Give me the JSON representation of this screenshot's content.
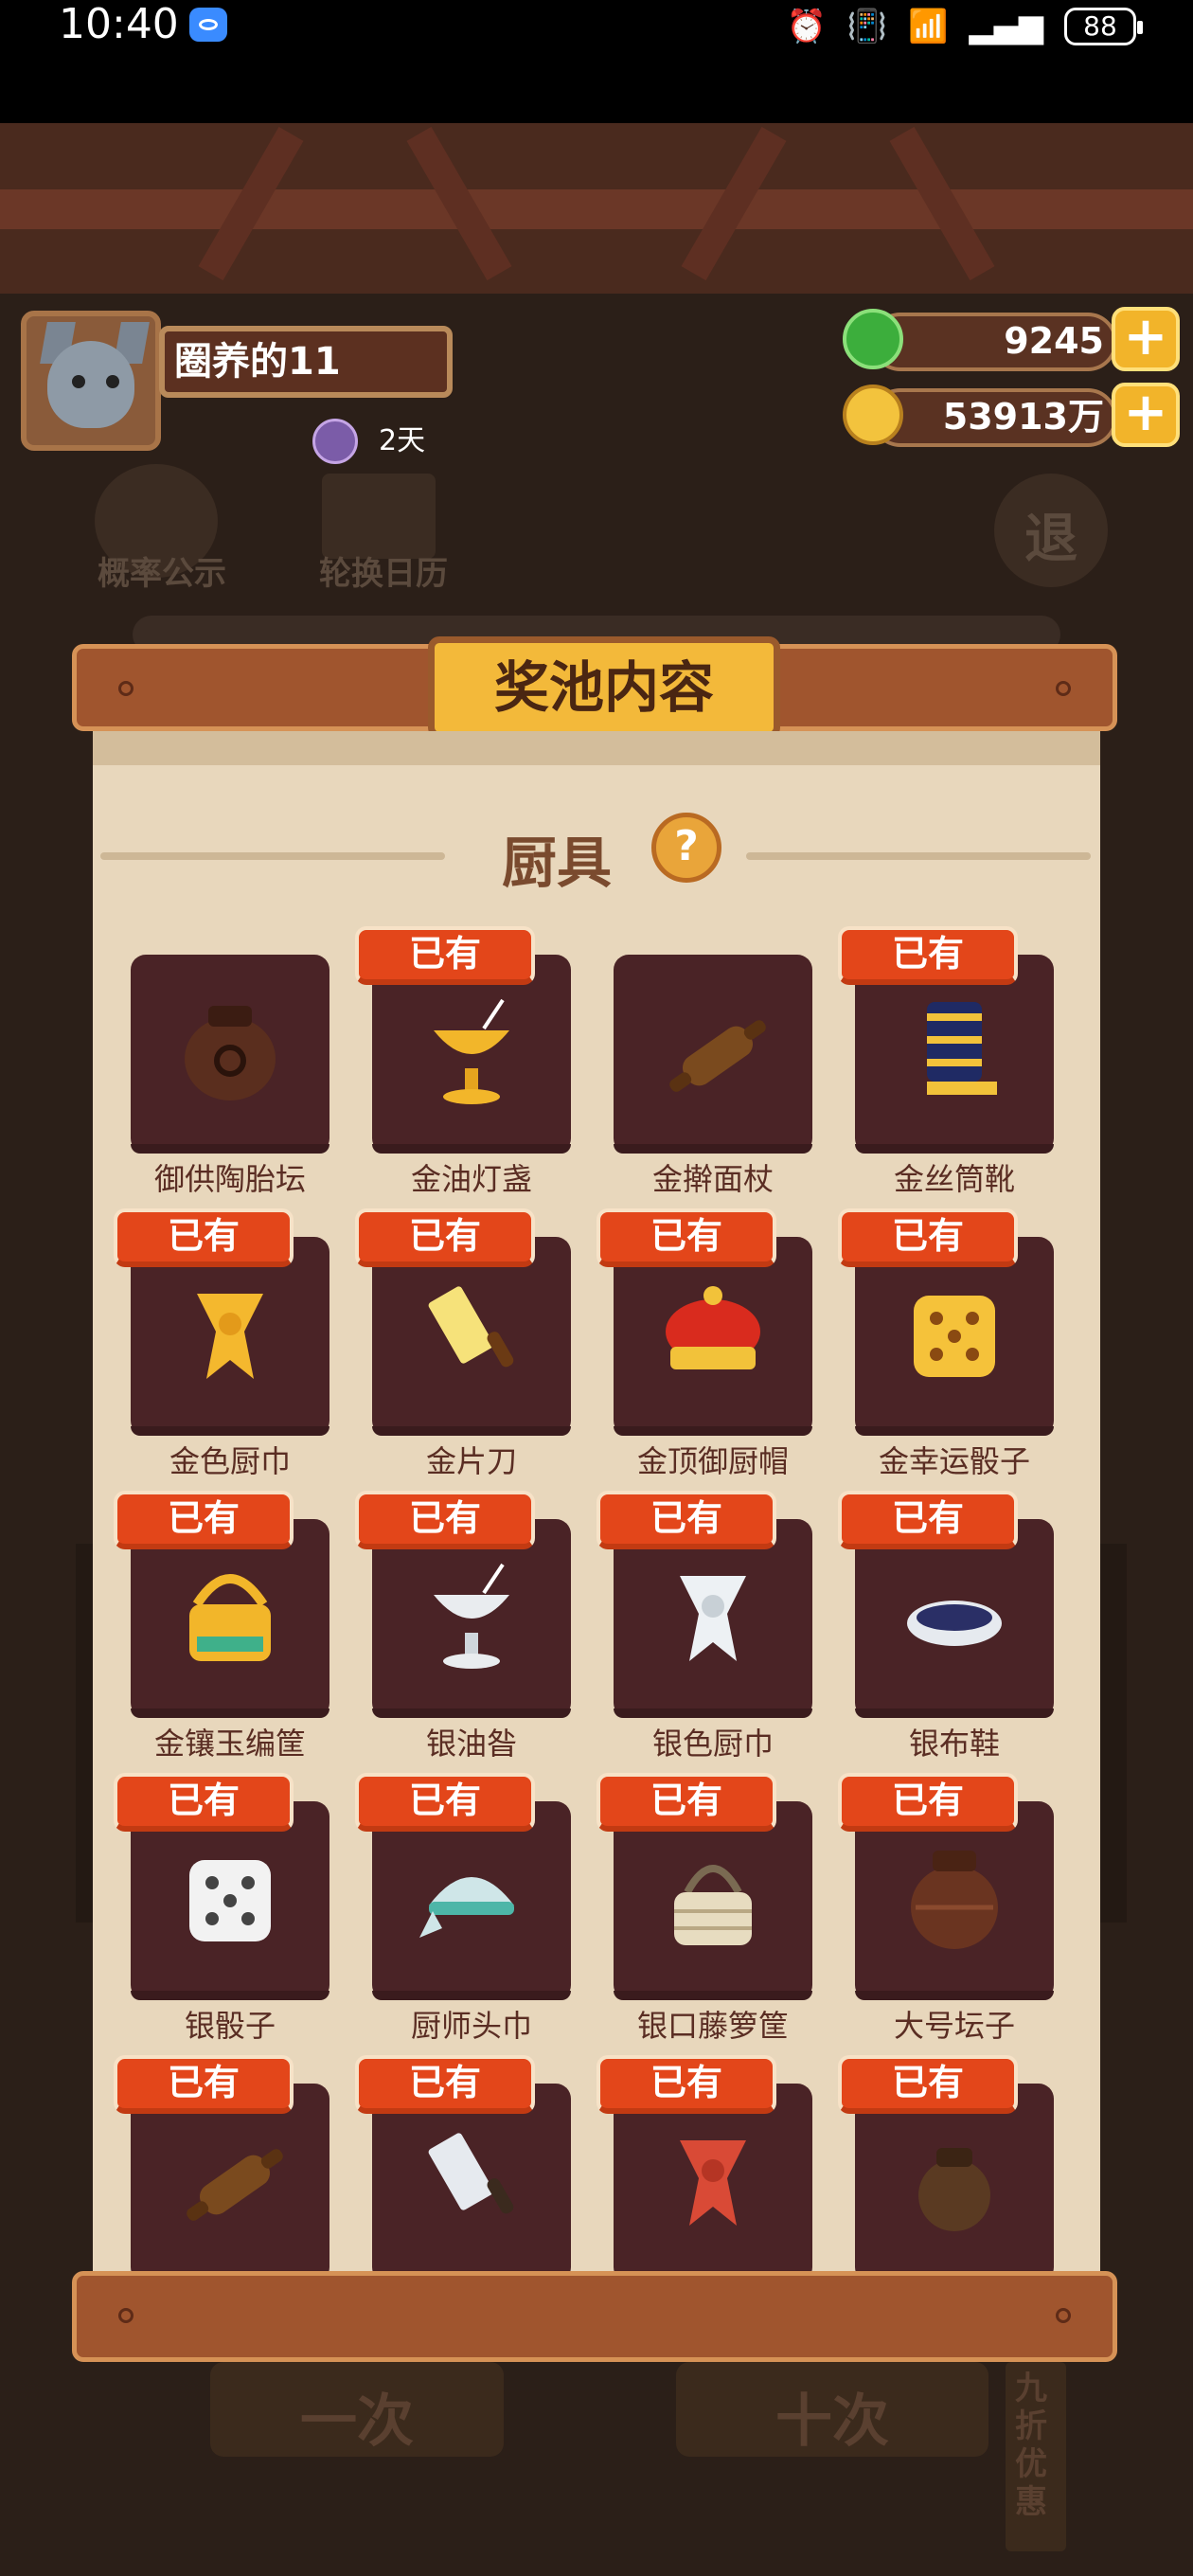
{
  "status_bar": {
    "time": "10:40",
    "battery": "88",
    "icons": [
      "alarm-icon",
      "vibrate-icon",
      "wifi-icon",
      "signal-icon"
    ]
  },
  "player": {
    "name": "圈养的11",
    "days": "2天"
  },
  "resources": {
    "jade": "9245",
    "coins": "53913万"
  },
  "background_buttons": {
    "probability": "概率公示",
    "calendar": "轮换日历",
    "exit": "退",
    "discount": "九折优惠",
    "draw_one": "一次",
    "draw_ten": "十次"
  },
  "modal": {
    "title": "奖池内容",
    "section_title": "厨具",
    "help_label": "?",
    "owned_label": "已有",
    "items": [
      {
        "name": "御供陶胎坛",
        "owned": false,
        "icon": "ceramic-jar-icon"
      },
      {
        "name": "金油灯盏",
        "owned": true,
        "icon": "golden-oil-lamp-icon"
      },
      {
        "name": "金擀面杖",
        "owned": false,
        "icon": "rolling-pin-icon"
      },
      {
        "name": "金丝筒靴",
        "owned": true,
        "icon": "boot-icon"
      },
      {
        "name": "金色厨巾",
        "owned": true,
        "icon": "golden-scarf-icon"
      },
      {
        "name": "金片刀",
        "owned": true,
        "icon": "golden-cleaver-icon"
      },
      {
        "name": "金顶御厨帽",
        "owned": true,
        "icon": "chef-hat-icon"
      },
      {
        "name": "金幸运骰子",
        "owned": true,
        "icon": "golden-dice-icon"
      },
      {
        "name": "金镶玉编筐",
        "owned": true,
        "icon": "golden-basket-icon"
      },
      {
        "name": "银油昝",
        "owned": true,
        "icon": "silver-oil-lamp-icon"
      },
      {
        "name": "银色厨巾",
        "owned": true,
        "icon": "silver-scarf-icon"
      },
      {
        "name": "银布鞋",
        "owned": true,
        "icon": "silver-shoe-icon"
      },
      {
        "name": "银骰子",
        "owned": true,
        "icon": "silver-dice-icon"
      },
      {
        "name": "厨师头巾",
        "owned": true,
        "icon": "chef-bandana-icon"
      },
      {
        "name": "银口藤箩筐",
        "owned": true,
        "icon": "rattan-basket-icon"
      },
      {
        "name": "大号坛子",
        "owned": true,
        "icon": "large-jar-icon"
      },
      {
        "name": "",
        "owned": true,
        "icon": "rolling-pin-icon"
      },
      {
        "name": "",
        "owned": true,
        "icon": "cleaver-icon"
      },
      {
        "name": "",
        "owned": true,
        "icon": "red-scarf-icon"
      },
      {
        "name": "",
        "owned": true,
        "icon": "small-jar-icon"
      }
    ]
  },
  "colors": {
    "badge": "#e3461a",
    "card": "#4a2326",
    "paper": "#e8d7bc",
    "plaque": "#f3b93a"
  }
}
